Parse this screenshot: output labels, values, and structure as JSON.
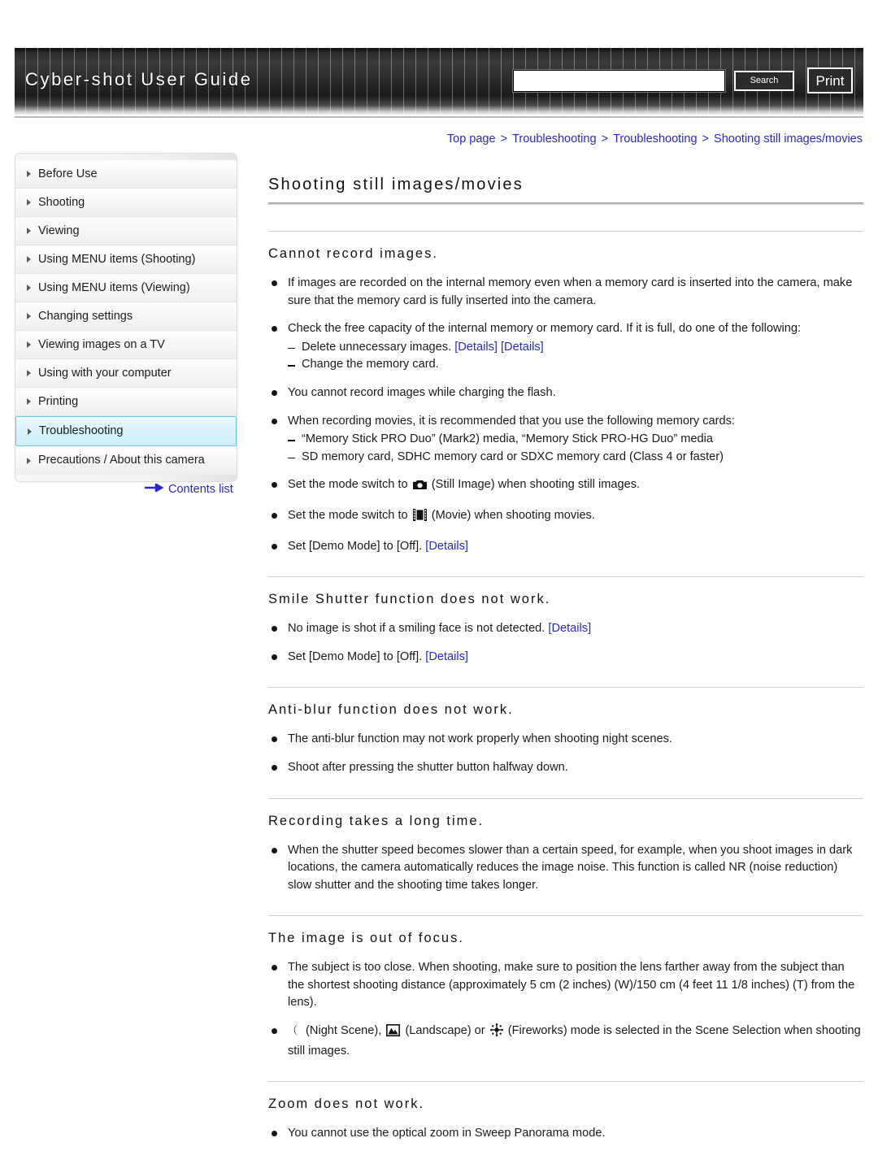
{
  "header": {
    "site_title": "Cyber-shot User Guide",
    "search_value": "",
    "search_placeholder": "",
    "search_label": "Search",
    "print_label": "Print"
  },
  "breadcrumb": {
    "items": [
      "Top page",
      "Troubleshooting",
      "Troubleshooting",
      "Shooting still images/movies"
    ],
    "separator": ">"
  },
  "sidebar": {
    "items": [
      {
        "label": "Before Use",
        "active": false
      },
      {
        "label": "Shooting",
        "active": false
      },
      {
        "label": "Viewing",
        "active": false
      },
      {
        "label": "Using MENU items (Shooting)",
        "active": false
      },
      {
        "label": "Using MENU items (Viewing)",
        "active": false
      },
      {
        "label": "Changing settings",
        "active": false
      },
      {
        "label": "Viewing images on a TV",
        "active": false
      },
      {
        "label": "Using with your computer",
        "active": false
      },
      {
        "label": "Printing",
        "active": false
      },
      {
        "label": "Troubleshooting",
        "active": true
      },
      {
        "label": "Precautions / About this camera",
        "active": false
      }
    ],
    "contents_link": "Contents list"
  },
  "main": {
    "page_title": "Shooting still images/movies",
    "sections": [
      {
        "title": "Cannot record images.",
        "bullets": [
          {
            "text": "If images are recorded on the internal memory even when a memory card is inserted into the camera, make sure that the memory card is fully inserted into the camera."
          },
          {
            "text": "Check the free capacity of the internal memory or memory card. If it is full, do one of the following:",
            "sub": [
              {
                "text": "Delete unnecessary images.",
                "links": [
                  "[Details]",
                  "[Details]"
                ]
              },
              {
                "text": "Change the memory card."
              }
            ]
          },
          {
            "text": "You cannot record images while charging the flash."
          },
          {
            "text": "When recording movies, it is recommended that you use the following memory cards:",
            "sub": [
              {
                "text": "“Memory Stick PRO Duo” (Mark2) media, “Memory Stick PRO-HG Duo” media"
              },
              {
                "text": "SD memory card, SDHC memory card or SDXC memory card (Class 4 or faster)"
              }
            ]
          },
          {
            "prefix": "Set the mode switch to",
            "icon": "still-image-icon",
            "suffix": "(Still Image) when shooting still images."
          },
          {
            "prefix": "Set the mode switch to",
            "icon": "movie-icon",
            "suffix": "(Movie) when shooting movies."
          },
          {
            "text": "Set [Demo Mode] to [Off].",
            "links": [
              "[Details]"
            ]
          }
        ]
      },
      {
        "title": "Smile Shutter function does not work.",
        "bullets": [
          {
            "text": "No image is shot if a smiling face is not detected.",
            "links": [
              "[Details]"
            ]
          },
          {
            "text": "Set [Demo Mode] to [Off].",
            "links": [
              "[Details]"
            ]
          }
        ]
      },
      {
        "title": "Anti-blur function does not work.",
        "bullets": [
          {
            "text": "The anti-blur function may not work properly when shooting night scenes."
          },
          {
            "text": "Shoot after pressing the shutter button halfway down."
          }
        ]
      },
      {
        "title": "Recording takes a long time.",
        "bullets": [
          {
            "text": "When the shutter speed becomes slower than a certain speed, for example, when you shoot images in dark locations, the camera automatically reduces the image noise. This function is called NR (noise reduction) slow shutter and the shooting time takes longer."
          }
        ]
      },
      {
        "title": "The image is out of focus.",
        "bullets": [
          {
            "text": "The subject is too close. When shooting, make sure to position the lens farther away from the subject than the shortest shooting distance (approximately 5 cm (2 inches) (W)/150 cm (4 feet 11 1/8 inches) (T) from the lens)."
          },
          {
            "scene_line": true,
            "labels": [
              "(Night Scene),",
              "(Landscape) or",
              "(Fireworks) mode is selected in the Scene Selection when shooting still images."
            ]
          }
        ]
      },
      {
        "title": "Zoom does not work.",
        "bullets": [
          {
            "text": "You cannot use the optical zoom in Sweep Panorama mode."
          }
        ]
      }
    ]
  },
  "colors": {
    "link": "#2727cf",
    "active_nav_bg": "#d9f3fb",
    "active_nav_border": "#6ec8e0",
    "header_dark": "#262626"
  }
}
